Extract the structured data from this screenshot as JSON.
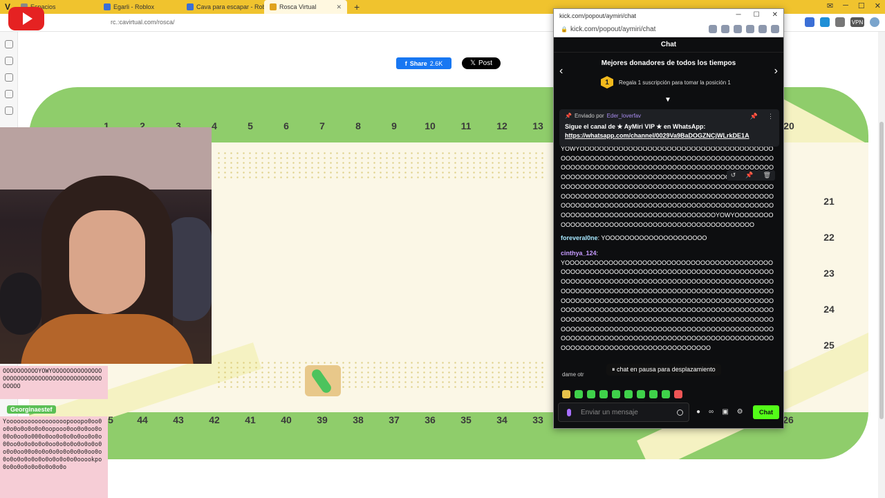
{
  "browser": {
    "tabs": [
      {
        "label": "Espacios",
        "active": false
      },
      {
        "label": "Egarli - Roblox",
        "active": false
      },
      {
        "label": "Cava para escapar - Roblox",
        "active": false
      },
      {
        "label": "Rosca Virtual",
        "active": true
      }
    ],
    "new_tab": "+",
    "address": "rc.:cavirtual.com/rosca/",
    "extensions": [
      "vpn-icon",
      "puzzle-icon",
      "globe-icon"
    ]
  },
  "page": {
    "share": {
      "label": "Share",
      "count": "2.6K"
    },
    "post": {
      "label": "Post"
    },
    "board": {
      "top_numbers": [
        "1",
        "2",
        "3",
        "4",
        "5",
        "6",
        "7",
        "8",
        "9",
        "10",
        "11",
        "12",
        "13",
        "20"
      ],
      "right_numbers": [
        "21",
        "22",
        "23",
        "24",
        "25",
        "26"
      ],
      "bottom_numbers": [
        "5",
        "44",
        "43",
        "42",
        "41",
        "40",
        "39",
        "38",
        "37",
        "36",
        "35",
        "34",
        "33"
      ]
    }
  },
  "overlay": {
    "box1": "OOOOOOOOOOYOWYOOOOOOOOOOOOOOOOOOOOOOOOOOOOOOOOOOOOOOOOOOOOOOO",
    "user": "Georginaestef",
    "box2": "Yooooooooooooooooopooopo0oo0o0o0o0o0o0o0oopooo0oo0o0oo0o00o0oo0o000o0oo0o0o0o0oo0o0o00oo0o0o0o0o0oo0o0o0o0o0o0o0o0o0oo00o0o0o0o0o0o0o0o0oo0o0o0o0o0o0o0o0o0o0o0o0ooookpo0o0o0o0o0o0o0o0o0o"
  },
  "popup": {
    "title": "kick.com/popout/aymiri/chat",
    "url": "kick.com/popout/aymiri/chat",
    "chat_header": "Chat",
    "donors_title": "Mejores donadores de todos los tiempos",
    "donors_rank": "1",
    "donors_text": "Regala 1 suscripción para tomar la posición 1",
    "pinned": {
      "sent_by": "Enviado por",
      "user": "Eder_loverfav",
      "line1": "Sigue el canal de ★ AyMiri VIP ★ en WhatsApp:",
      "link": "https://whatsapp.com/channel/0029Va9BaDOGZNCjWLrkDE1A"
    },
    "messages": [
      {
        "user": "",
        "text": "YOWYOOOOOOOOOOOOOOOOOOOOOOOOOOOOOOOOOOOOOOOOOOOOOOOOOOOOOOOOOOOOOOOOOOOOOOOOOOOOOOOOOOOOOOOOOOOOOOOOOOOOOOOOOOOOOOOOOOOOOOOOOOOOOOOOOOOOOOOOOOOOOOOOOOOOOOOOOOOOOOOOOOOOOOOOOOOOOOOOOOOOOOOOOOOOOOOOOOOOOOOOOOOOOOOOOOOOOOOOOOOOOOOOOOOOOOOOOOOOOOOOOOOOOOOOOOOOOOOOOOOOOOOOOOOOOOOOOOOOOOOOOOOOOOOOOOOOOOOOOOOOOOOOOOOOOOOOOOOOOOOOOOOOOOOOOOOOOOOOYOWYOOOOOOOOOOOOOOOOOOOOOOOOOOOOOOOOOOOOOOOOOOOOOOOO"
      },
      {
        "user": "foreveral0ne",
        "text": "YOOOOOOOOOOOOOOOOOOOOO"
      },
      {
        "user": "cinthya_124",
        "text": "YOOOOOOOOOOOOOOOOOOOOOOOOOOOOOOOOOOOOOOOOOOOOOOOOOOOOOOOOOOOOOOOOOOOOOOOOOOOOOOOOOOOOOOOOOOOOOOOOOOOOOOOOOOOOOOOOOOOOOOOOOOOOOOOOOOOOOOOOOOOOOOOOOOOOOOOOOOOOOOOOOOOOOOOOOOOOOOOOOOOOOOOOOOOOOOOOOOOOOOOOOOOOOOOOOOOOOOOOOOOOOOOOOOOOOOOOOOOOOOOOOOOOOOOOOOOOOOOOOOOOOOOOOOOOOOOOOOOOOOOOOOOOOOOOOOOOOOOOOOOOOOOOOOOOOOOOOOOOOOOOOOOOOOOOOOOOOOOOOOOOOOOOOOOOOOOOOOOOOOOOOOOOOOOOOOOOOOOOOOOOOOOOOOOOOOOOOOOOOOOOOOOOOOOOOOOOOOOOOOOOOOOOOO"
      }
    ],
    "paused": "chat en pausa para desplazamiento",
    "dame": "dame otr",
    "input_placeholder": "Enviar un mensaje",
    "infinity": "∞",
    "chat_button": "Chat"
  },
  "colors": {
    "kick_green": "#53fc18",
    "board_green": "#8fcd6b",
    "board_cream": "#fbf7e6",
    "tabbar_yellow": "#f0c32e"
  }
}
